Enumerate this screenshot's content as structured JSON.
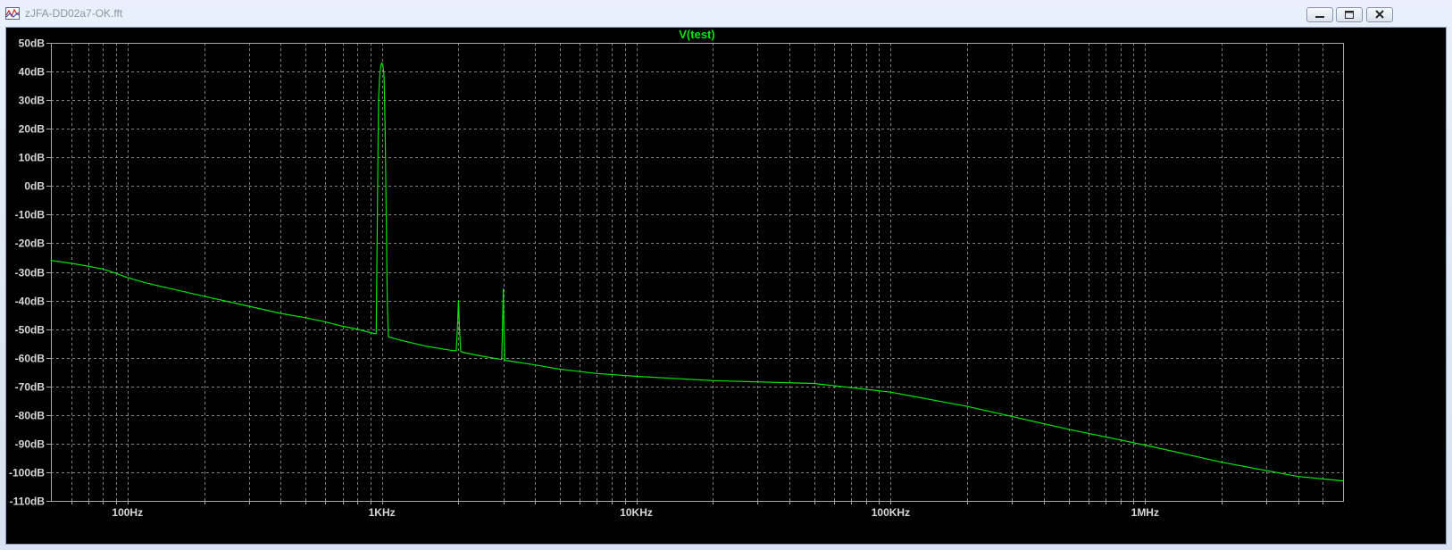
{
  "window": {
    "title": "zJFA-DD02a7-OK.fft",
    "app_icon": "waveform-icon",
    "controls": {
      "minimize": "minimize-icon",
      "maximize": "maximize-icon",
      "close": "close-icon"
    }
  },
  "colors": {
    "background": "#000000",
    "trace": "#00e600",
    "grid": "#808080",
    "tick_text": "#d8d8d8"
  },
  "chart_data": {
    "type": "line",
    "title": "V(test)",
    "xlabel": "",
    "ylabel": "",
    "x_scale": "log",
    "xlim": [
      50,
      6000000
    ],
    "ylim": [
      -110,
      50
    ],
    "grid": true,
    "x_tick_labels": [
      "100Hz",
      "1KHz",
      "10KHz",
      "100KHz",
      "1MHz"
    ],
    "x_tick_values": [
      100,
      1000,
      10000,
      100000,
      1000000
    ],
    "y_tick_labels": [
      "50dB",
      "40dB",
      "30dB",
      "20dB",
      "10dB",
      "0dB",
      "-10dB",
      "-20dB",
      "-30dB",
      "-40dB",
      "-50dB",
      "-60dB",
      "-70dB",
      "-80dB",
      "-90dB",
      "-100dB",
      "-110dB"
    ],
    "y_tick_values": [
      50,
      40,
      30,
      20,
      10,
      0,
      -10,
      -20,
      -30,
      -40,
      -50,
      -60,
      -70,
      -80,
      -90,
      -100,
      -110
    ],
    "series": [
      {
        "name": "V(test)",
        "color": "#00e600",
        "x": [
          50,
          60,
          70,
          80,
          90,
          100,
          120,
          150,
          200,
          300,
          400,
          500,
          600,
          700,
          800,
          900,
          940,
          950,
          960,
          970,
          980,
          990,
          1000,
          1010,
          1020,
          1030,
          1040,
          1050,
          1060,
          1070,
          1200,
          1500,
          1900,
          1960,
          1980,
          2000,
          2020,
          2040,
          2100,
          2500,
          2900,
          2960,
          2980,
          3000,
          3020,
          3040,
          3100,
          4000,
          5000,
          7000,
          10000,
          20000,
          50000,
          100000,
          200000,
          500000,
          1000000,
          2000000,
          4000000,
          6000000
        ],
        "y": [
          -26,
          -27,
          -28,
          -29,
          -30.5,
          -32,
          -34,
          -36,
          -38.5,
          -42,
          -44.5,
          -46,
          -47.5,
          -49,
          -50,
          -51.2,
          -51.6,
          -51.5,
          -10,
          30,
          38,
          42,
          43,
          42,
          38,
          20,
          -10,
          -40,
          -52.5,
          -52.8,
          -54,
          -56,
          -57.5,
          -57.5,
          -50,
          -40,
          -50,
          -57.8,
          -58.2,
          -59.5,
          -60.5,
          -60.5,
          -50,
          -36,
          -50,
          -60.8,
          -61,
          -62.5,
          -64,
          -65.5,
          -66.5,
          -68,
          -69,
          -72,
          -77,
          -85,
          -90.5,
          -96.5,
          -101.5,
          -103
        ]
      }
    ]
  }
}
